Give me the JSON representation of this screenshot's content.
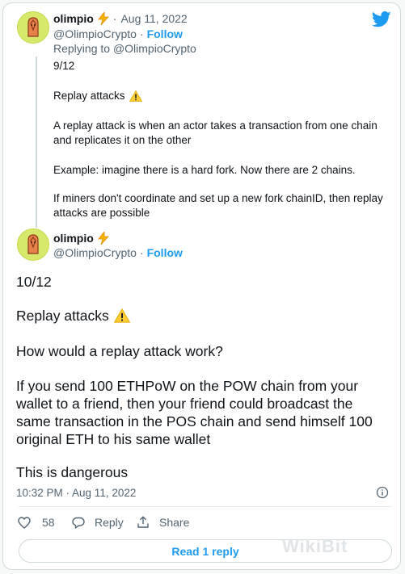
{
  "reply_tweet": {
    "name": "olimpio",
    "handle": "@OlimpioCrypto",
    "separator": "·",
    "date": "Aug 11, 2022",
    "follow": "Follow",
    "replying_to_prefix": "Replying to",
    "replying_to_handle": "@OlimpioCrypto",
    "lines": [
      "9/12",
      "Replay attacks",
      "A replay attack is when an actor takes a transaction from one chain",
      "and replicates it on the other",
      "Example: imagine there is a hard fork. Now there are 2 chains.",
      "If miners don't coordinate and set up a new fork chainID, then replay",
      "attacks are possible"
    ]
  },
  "main_tweet": {
    "name": "olimpio",
    "handle": "@OlimpioCrypto",
    "separator": "·",
    "follow": "Follow",
    "lines": [
      "10/12",
      "Replay attacks",
      "How would a replay attack work?",
      "If you send 100 ETHPoW on the POW chain from your",
      "wallet to a friend, then your friend could broadcast the",
      "same transaction in the POS chain and send himself 100",
      "original ETH to his same wallet",
      "This is dangerous"
    ],
    "timestamp": "10:32 PM · Aug 11, 2022"
  },
  "actions": {
    "likes": "58",
    "reply_label": "Reply",
    "share_label": "Share"
  },
  "read_replies": "Read 1 reply",
  "watermark": "WikiBit",
  "icons": {
    "bird": "twitter-bird-icon",
    "lightning": "lightning-emoji-icon",
    "warning": "warning-emoji-icon",
    "info": "info-icon",
    "heart": "heart-icon",
    "reply": "reply-bubble-icon",
    "share": "share-icon"
  },
  "colors": {
    "accent": "#1d9bf0",
    "text": "#0f1419",
    "muted": "#536471",
    "avatar_bg": "#d7e86a"
  }
}
